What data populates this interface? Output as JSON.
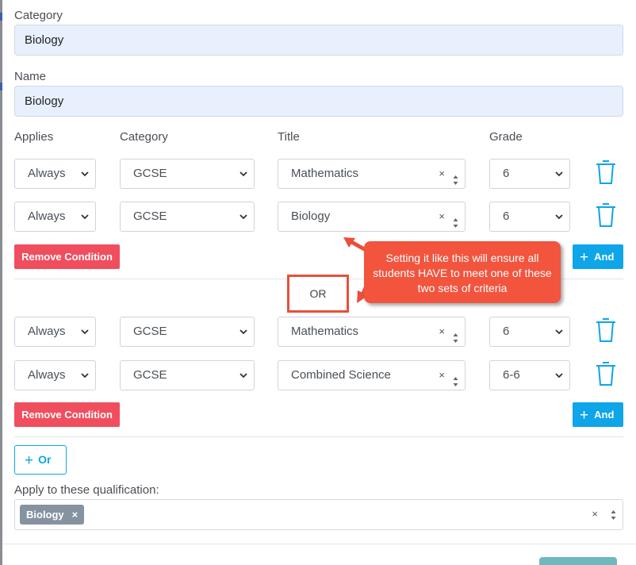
{
  "form": {
    "category_label": "Category",
    "category_value": "Biology",
    "name_label": "Name",
    "name_value": "Biology"
  },
  "columns": {
    "applies": "Applies",
    "category": "Category",
    "title": "Title",
    "grade": "Grade"
  },
  "groups": [
    {
      "rows": [
        {
          "applies": "Always",
          "category": "GCSE",
          "title": "Mathematics",
          "grade": "6"
        },
        {
          "applies": "Always",
          "category": "GCSE",
          "title": "Biology",
          "grade": "6"
        }
      ],
      "remove_label": "Remove Condition",
      "and_label": "And"
    },
    {
      "rows": [
        {
          "applies": "Always",
          "category": "GCSE",
          "title": "Mathematics",
          "grade": "6"
        },
        {
          "applies": "Always",
          "category": "GCSE",
          "title": "Combined Science",
          "grade": "6-6"
        }
      ],
      "remove_label": "Remove Condition",
      "and_label": "And"
    }
  ],
  "or_separator": "OR",
  "or_button_label": "Or",
  "annotation": {
    "text": "Setting it like this will ensure all students HAVE to meet one of these two sets of criteria",
    "color": "#f2543e"
  },
  "qualifications": {
    "label": "Apply to these qualification:",
    "tags": [
      "Biology"
    ]
  },
  "icons": {
    "clear": "×",
    "trash": "trash-icon",
    "chevron": "chevron-down-icon"
  },
  "colors": {
    "danger": "#f04e5e",
    "primary": "#0ea5e9",
    "filled_input": "#e8f0fe"
  }
}
